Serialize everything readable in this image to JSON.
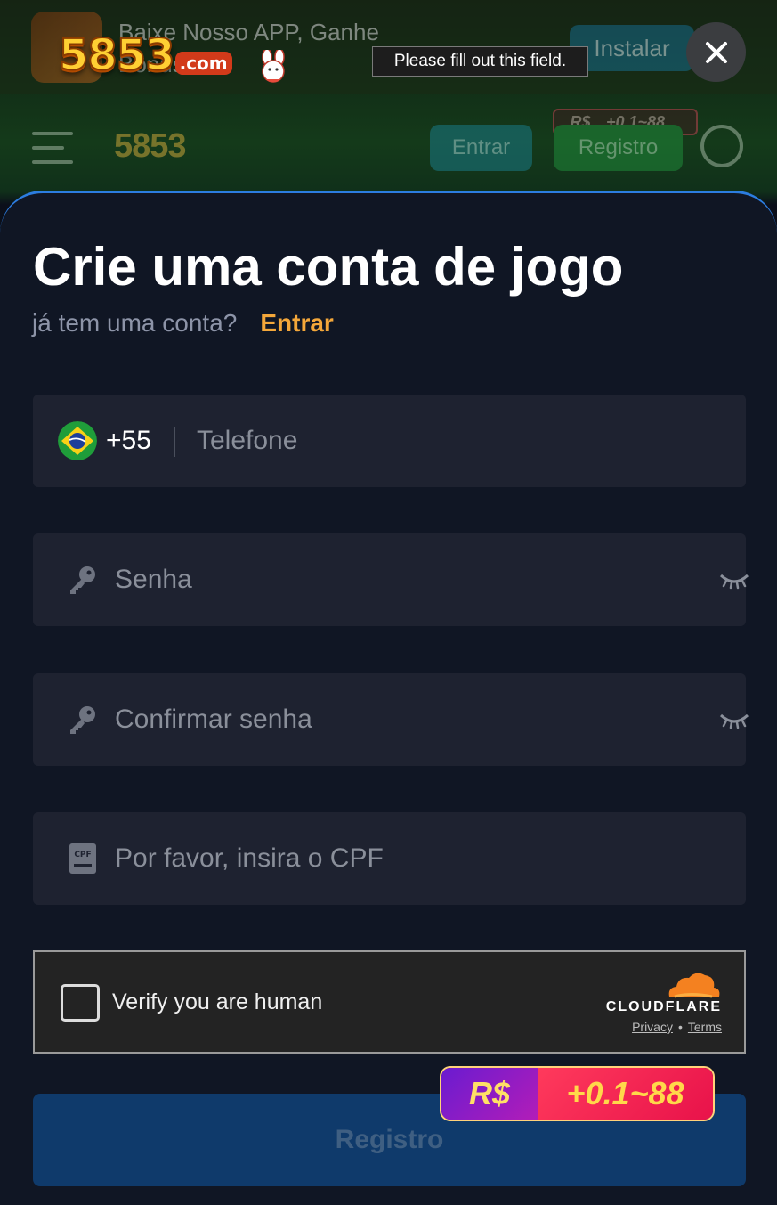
{
  "background": {
    "banner_text": "Baixe Nosso APP, Ganhe Bônus!",
    "install_label": "Instalar",
    "login_label": "Entrar",
    "register_label": "Registro",
    "mini_badge_currency": "R$",
    "mini_badge_amount": "+0.1~88"
  },
  "logo": {
    "number": "5853",
    "suffix": ".com"
  },
  "tooltip": {
    "text": "Please fill out this field."
  },
  "modal": {
    "title": "Crie uma conta de jogo",
    "subtitle_question": "já tem uma conta?",
    "subtitle_link": "Entrar",
    "phone": {
      "country_prefix": "+55",
      "placeholder": "Telefone",
      "flag_icon": "brazil-flag-icon"
    },
    "password": {
      "placeholder": "Senha",
      "icon": "key-icon",
      "toggle_icon": "eye-closed-icon"
    },
    "confirm_password": {
      "placeholder": "Confirmar senha",
      "icon": "key-icon",
      "toggle_icon": "eye-closed-icon"
    },
    "cpf": {
      "placeholder": "Por favor, insira o CPF",
      "icon": "cpf-card-icon"
    },
    "captcha": {
      "label": "Verify you are human",
      "brand": "CLOUDFLARE",
      "privacy": "Privacy",
      "separator": "•",
      "terms": "Terms"
    },
    "submit_label": "Registro",
    "promo": {
      "currency": "R$",
      "amount": "+0.1~88"
    }
  },
  "colors": {
    "accent_link": "#f4a73a",
    "modal_bg": "#101624",
    "field_bg": "#1e2230",
    "submit_bg": "#0f3a6b",
    "cloudflare_orange": "#f48120"
  }
}
